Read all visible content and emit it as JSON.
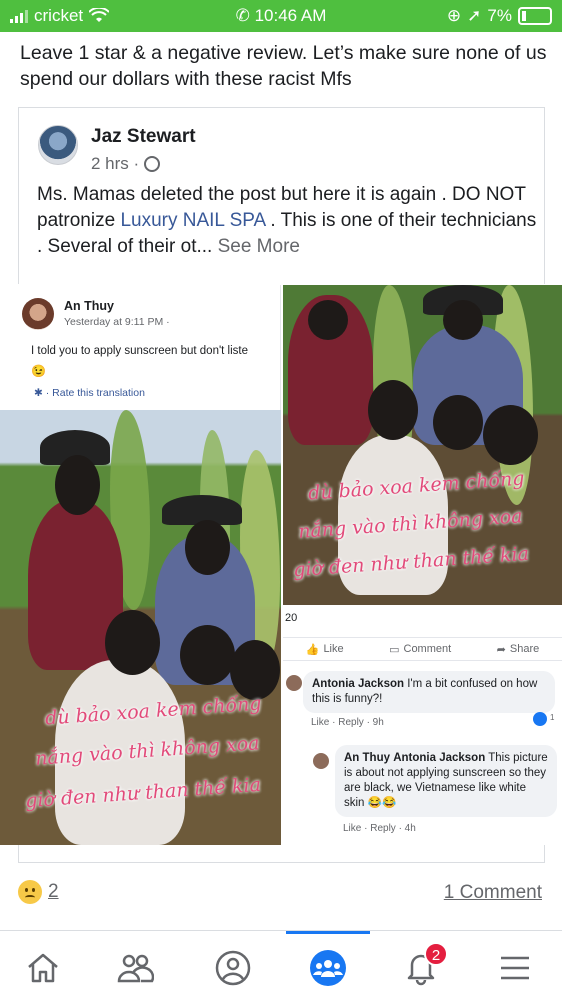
{
  "status_bar": {
    "carrier": "cricket",
    "time": "10:46 AM",
    "battery": "7%"
  },
  "post": {
    "text": "Leave 1 star & a negative review. Let’s make sure none of us spend our dollars with these racist Mfs"
  },
  "shared_post": {
    "author": "Jaz Stewart",
    "time": "2 hrs ·",
    "body_part1": "Ms. Mamas deleted the post but here it is again . DO NOT patronize ",
    "link_text": "Luxury NAIL SPA",
    "body_part2": " . This is one of their technicians . Several of their ot...",
    "see_more": "See More"
  },
  "screenshot_left": {
    "author": "An Thuy",
    "time": "Yesterday at 9:11 PM ·",
    "text": "I told you to apply sunscreen but don't liste",
    "emoji": "😉",
    "rate_translation": "· Rate this translation",
    "caption_line1": "dù bảo xoa kem chống",
    "caption_line2": "nắng vào thì không xoa",
    "caption_line3": "giờ đen như than thế kia"
  },
  "screenshot_right": {
    "caption_line1": "dù bảo xoa kem chống",
    "caption_line2": "nắng vào thì không xoa",
    "caption_line3": "giờ đen như than thế kia",
    "reaction_count": "20",
    "actions": {
      "like": "Like",
      "comment": "Comment",
      "share": "Share"
    },
    "comments": [
      {
        "author": "Antonia Jackson",
        "text": "I'm a bit confused on how this is funny?!",
        "meta": "Like · Reply · 9h",
        "reactions": "1"
      },
      {
        "author": "An Thuy",
        "mention": "Antonia Jackson",
        "text": "This picture is about not applying sunscreen so they are black, we Vietnamese like white skin 😂😂",
        "meta": "Like · Reply · 4h"
      }
    ]
  },
  "footer": {
    "reaction_count": "2",
    "comments": "1 Comment"
  },
  "nav": {
    "items": [
      "home-icon",
      "friends-icon",
      "profile-icon",
      "groups-icon",
      "notifications-icon",
      "menu-icon"
    ],
    "notification_badge": "2",
    "active_color": "#1877f2"
  }
}
